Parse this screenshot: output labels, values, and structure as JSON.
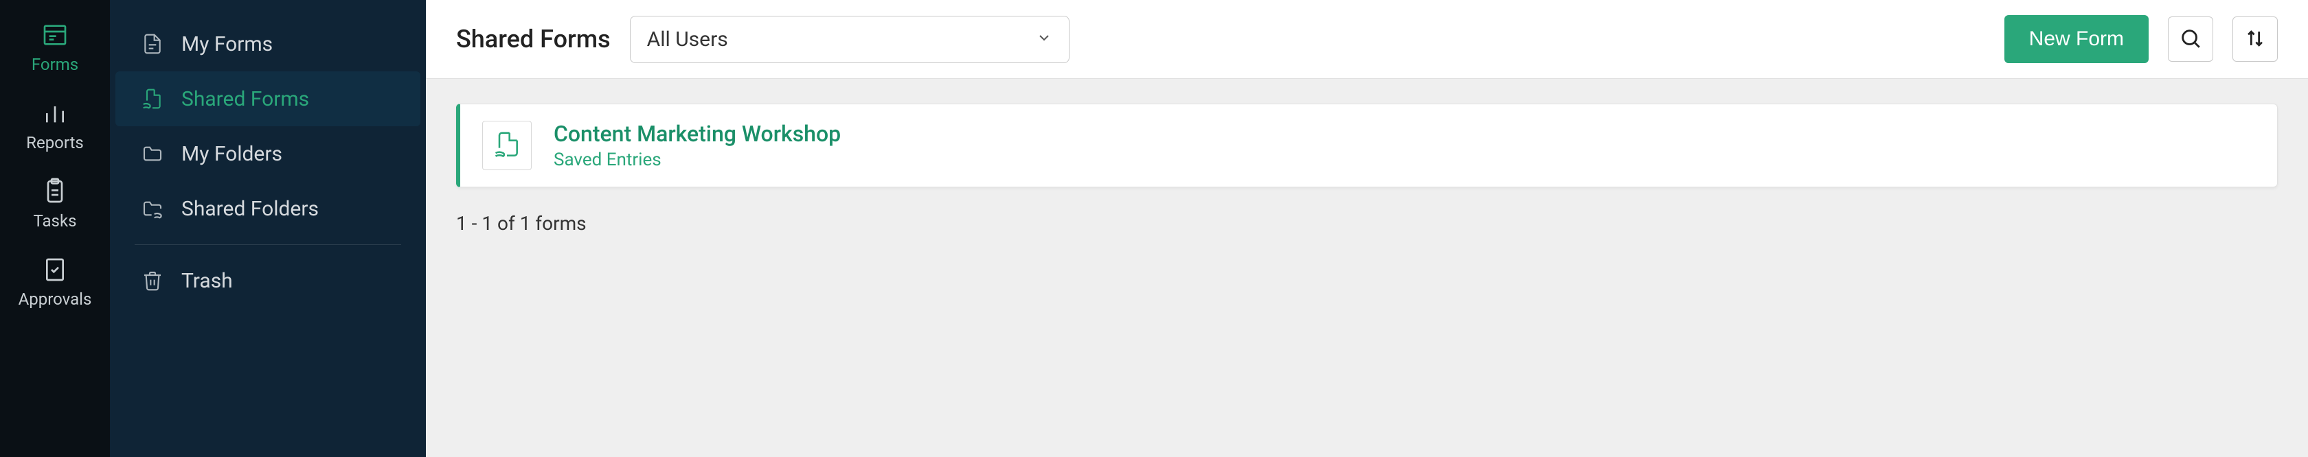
{
  "navrail": [
    {
      "label": "Forms",
      "icon": "form-icon",
      "active": true
    },
    {
      "label": "Reports",
      "icon": "reports-icon",
      "active": false
    },
    {
      "label": "Tasks",
      "icon": "tasks-icon",
      "active": false
    },
    {
      "label": "Approvals",
      "icon": "approvals-icon",
      "active": false
    }
  ],
  "sidebar": [
    {
      "label": "My Forms",
      "icon": "file-icon",
      "active": false
    },
    {
      "label": "Shared Forms",
      "icon": "shared-file-icon",
      "active": true
    },
    {
      "label": "My Folders",
      "icon": "folder-icon",
      "active": false
    },
    {
      "label": "Shared Folders",
      "icon": "shared-folder-icon",
      "active": false
    },
    {
      "label": "Trash",
      "icon": "trash-icon",
      "active": false,
      "divider_before": true
    }
  ],
  "page": {
    "title": "Shared Forms",
    "user_filter": "All Users",
    "new_form_label": "New Form"
  },
  "forms": [
    {
      "title": "Content Marketing Workshop",
      "subtitle": "Saved Entries"
    }
  ],
  "count_text": "1 - 1 of 1 forms",
  "colors": {
    "accent": "#2aa77a",
    "navrail_bg": "#0a1015",
    "sidebar_bg": "#0f2436"
  }
}
